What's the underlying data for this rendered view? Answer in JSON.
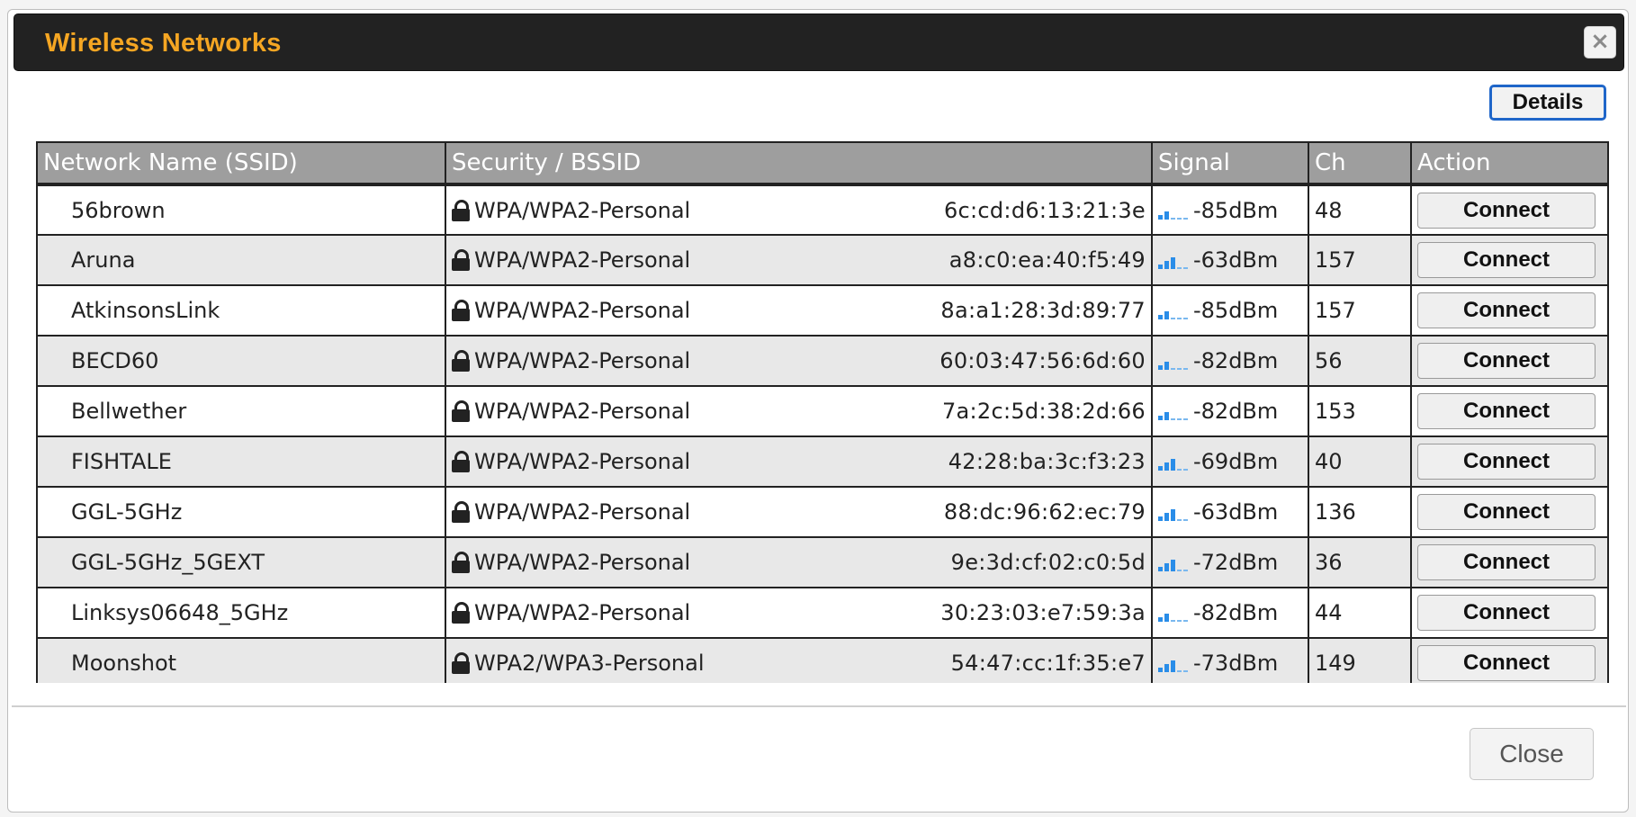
{
  "dialog": {
    "title": "Wireless Networks",
    "close_icon": "×",
    "details_label": "Details",
    "close_label": "Close"
  },
  "table": {
    "headers": [
      "Network Name (SSID)",
      "Security / BSSID",
      "Signal",
      "Ch",
      "Action"
    ],
    "rows": [
      {
        "ssid": "56brown",
        "security": "WPA/WPA2-Personal",
        "bssid": "6c:cd:d6:13:21:3e",
        "signal": "-85dBm",
        "bars": 2,
        "ch": "48",
        "action": "Connect"
      },
      {
        "ssid": "Aruna",
        "security": "WPA/WPA2-Personal",
        "bssid": "a8:c0:ea:40:f5:49",
        "signal": "-63dBm",
        "bars": 3,
        "ch": "157",
        "action": "Connect"
      },
      {
        "ssid": "AtkinsonsLink",
        "security": "WPA/WPA2-Personal",
        "bssid": "8a:a1:28:3d:89:77",
        "signal": "-85dBm",
        "bars": 2,
        "ch": "157",
        "action": "Connect"
      },
      {
        "ssid": "BECD60",
        "security": "WPA/WPA2-Personal",
        "bssid": "60:03:47:56:6d:60",
        "signal": "-82dBm",
        "bars": 2,
        "ch": "56",
        "action": "Connect"
      },
      {
        "ssid": "Bellwether",
        "security": "WPA/WPA2-Personal",
        "bssid": "7a:2c:5d:38:2d:66",
        "signal": "-82dBm",
        "bars": 2,
        "ch": "153",
        "action": "Connect"
      },
      {
        "ssid": "FISHTALE",
        "security": "WPA/WPA2-Personal",
        "bssid": "42:28:ba:3c:f3:23",
        "signal": "-69dBm",
        "bars": 3,
        "ch": "40",
        "action": "Connect"
      },
      {
        "ssid": "GGL-5GHz",
        "security": "WPA/WPA2-Personal",
        "bssid": "88:dc:96:62:ec:79",
        "signal": "-63dBm",
        "bars": 3,
        "ch": "136",
        "action": "Connect"
      },
      {
        "ssid": "GGL-5GHz_5GEXT",
        "security": "WPA/WPA2-Personal",
        "bssid": "9e:3d:cf:02:c0:5d",
        "signal": "-72dBm",
        "bars": 3,
        "ch": "36",
        "action": "Connect"
      },
      {
        "ssid": "Linksys06648_5GHz",
        "security": "WPA/WPA2-Personal",
        "bssid": "30:23:03:e7:59:3a",
        "signal": "-82dBm",
        "bars": 2,
        "ch": "44",
        "action": "Connect"
      },
      {
        "ssid": "Moonshot",
        "security": "WPA2/WPA3-Personal",
        "bssid": "54:47:cc:1f:35:e7",
        "signal": "-73dBm",
        "bars": 3,
        "ch": "149",
        "action": "Connect"
      }
    ]
  },
  "colors": {
    "title": "#f5a623",
    "titlebar": "#222222",
    "header_bg": "#9e9e9e",
    "signal": "#2a8de8",
    "details_border": "#1f66c9"
  },
  "icons": {
    "lock": "lock-icon",
    "signal": "signal-bars-icon",
    "close": "close-icon"
  }
}
